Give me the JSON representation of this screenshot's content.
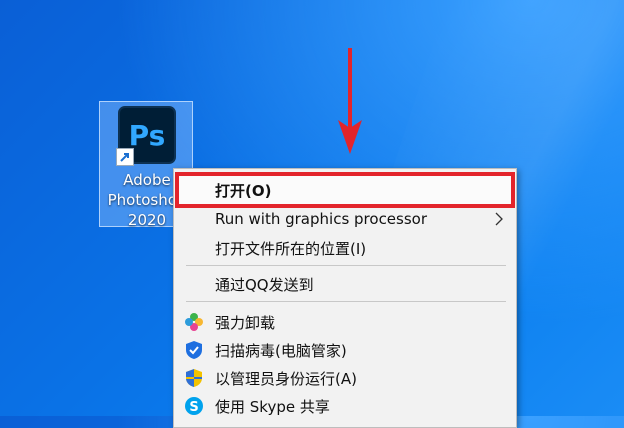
{
  "desktop": {
    "icon": {
      "glyph": "Ps",
      "label": "Adobe\nPhotoshop\n2020"
    },
    "accent_color": "#e3242b"
  },
  "context_menu": {
    "items": [
      {
        "label": "打开(O)",
        "icon": null,
        "bold": true,
        "highlighted": true
      },
      {
        "label": "Run with graphics processor",
        "icon": null,
        "submenu": true
      },
      {
        "label": "打开文件所在的位置(I)",
        "icon": null
      },
      {
        "label": "通过QQ发送到",
        "icon": null
      },
      {
        "label": "强力卸载",
        "icon": "clover-icon"
      },
      {
        "label": "扫描病毒(电脑管家)",
        "icon": "shield-icon"
      },
      {
        "label": "以管理员身份运行(A)",
        "icon": "uac-shield-icon"
      },
      {
        "label": "使用 Skype 共享",
        "icon": "skype-icon"
      }
    ]
  }
}
